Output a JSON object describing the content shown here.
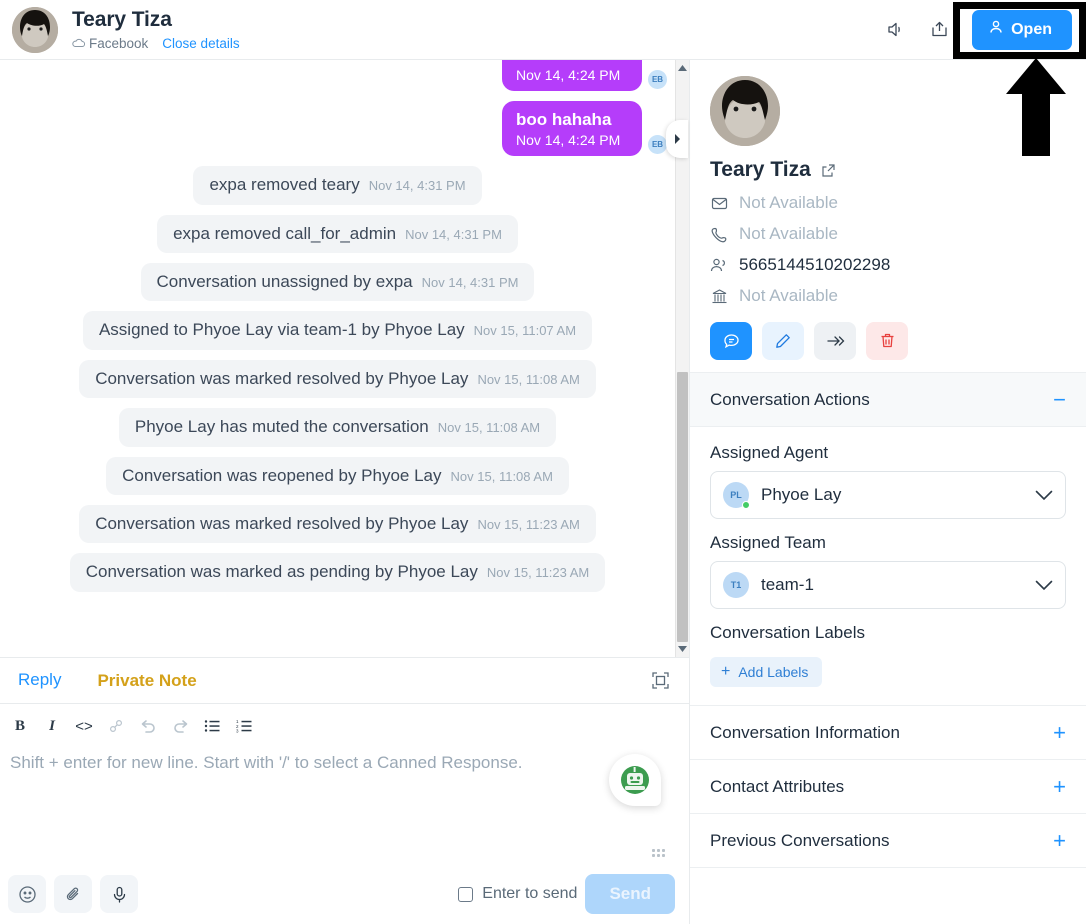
{
  "header": {
    "contact_name": "Teary Tiza",
    "channel": "Facebook",
    "close_details_label": "Close details",
    "mute_icon": "speaker-icon",
    "share_icon": "share-icon",
    "open_button_label": "Open",
    "accent_color": "#1f93ff"
  },
  "annotation": {
    "target": "open-button",
    "style": "black-box-and-arrow"
  },
  "messages": [
    {
      "type": "outgoing",
      "text": "",
      "timestamp": "Nov 14, 4:24 PM",
      "avatar_initials": "EB",
      "clipped": true
    },
    {
      "type": "outgoing",
      "text": "boo hahaha",
      "timestamp": "Nov 14, 4:24 PM",
      "avatar_initials": "EB",
      "clipped": false
    },
    {
      "type": "system",
      "text": "expa removed teary",
      "timestamp": "Nov 14, 4:31 PM"
    },
    {
      "type": "system",
      "text": "expa removed call_for_admin",
      "timestamp": "Nov 14, 4:31 PM"
    },
    {
      "type": "system",
      "text": "Conversation unassigned by expa",
      "timestamp": "Nov 14, 4:31 PM"
    },
    {
      "type": "system",
      "text": "Assigned to Phyoe Lay via team-1 by Phyoe Lay",
      "timestamp": "Nov 15, 11:07 AM"
    },
    {
      "type": "system",
      "text": "Conversation was marked resolved by Phyoe Lay",
      "timestamp": "Nov 15, 11:08 AM"
    },
    {
      "type": "system",
      "text": "Phyoe Lay has muted the conversation",
      "timestamp": "Nov 15, 11:08 AM"
    },
    {
      "type": "system",
      "text": "Conversation was reopened by Phyoe Lay",
      "timestamp": "Nov 15, 11:08 AM"
    },
    {
      "type": "system",
      "text": "Conversation was marked resolved by Phyoe Lay",
      "timestamp": "Nov 15, 11:23 AM"
    },
    {
      "type": "system",
      "text": "Conversation was marked as pending by Phyoe Lay",
      "timestamp": "Nov 15, 11:23 AM"
    }
  ],
  "reply_box": {
    "tab_reply": "Reply",
    "tab_private_note": "Private Note",
    "expand_icon": "expand-icon",
    "format_buttons": [
      {
        "name": "bold-button",
        "glyph": "B",
        "enabled": true
      },
      {
        "name": "italic-button",
        "glyph": "I",
        "enabled": true
      },
      {
        "name": "code-button",
        "glyph": "<>",
        "enabled": true
      },
      {
        "name": "link-button",
        "glyph": "link",
        "enabled": false
      },
      {
        "name": "undo-button",
        "glyph": "undo",
        "enabled": false
      },
      {
        "name": "redo-button",
        "glyph": "redo",
        "enabled": false
      },
      {
        "name": "bullet-list-button",
        "glyph": "bullets",
        "enabled": true
      },
      {
        "name": "ordered-list-button",
        "glyph": "numbers",
        "enabled": true
      }
    ],
    "placeholder": "Shift + enter for new line. Start with '/' to select a Canned Response.",
    "emoji_icon": "emoji-icon",
    "attach_icon": "paperclip-icon",
    "mic_icon": "microphone-icon",
    "enter_to_send_label": "Enter to send",
    "enter_to_send_checked": false,
    "send_label": "Send",
    "bot_widget_icon": "robot-icon"
  },
  "sidebar": {
    "contact": {
      "name": "Teary Tiza",
      "open_external_icon": "external-link-icon",
      "fields": [
        {
          "icon": "email-icon",
          "value": "Not Available",
          "available": false
        },
        {
          "icon": "phone-icon",
          "value": "Not Available",
          "available": false
        },
        {
          "icon": "identifier-icon",
          "value": "5665144510202298",
          "available": true
        },
        {
          "icon": "company-icon",
          "value": "Not Available",
          "available": false
        }
      ],
      "actions": [
        {
          "name": "new-message-button",
          "icon": "chat-icon",
          "style": "primary"
        },
        {
          "name": "edit-contact-button",
          "icon": "pencil-icon",
          "style": "edit"
        },
        {
          "name": "merge-contact-button",
          "icon": "merge-icon",
          "style": "merge"
        },
        {
          "name": "delete-contact-button",
          "icon": "trash-icon",
          "style": "del"
        }
      ]
    },
    "conversation_actions": {
      "title": "Conversation Actions",
      "collapse_sign": "−",
      "assigned_agent_label": "Assigned Agent",
      "assigned_agent_value": "Phyoe Lay",
      "assigned_agent_initials": "PL",
      "assigned_team_label": "Assigned Team",
      "assigned_team_value": "team-1",
      "assigned_team_initials": "T1",
      "conversation_labels_label": "Conversation Labels",
      "add_labels_label": "Add Labels"
    },
    "sections": [
      {
        "title": "Conversation Information",
        "sign": "+"
      },
      {
        "title": "Contact Attributes",
        "sign": "+"
      },
      {
        "title": "Previous Conversations",
        "sign": "+"
      }
    ]
  }
}
